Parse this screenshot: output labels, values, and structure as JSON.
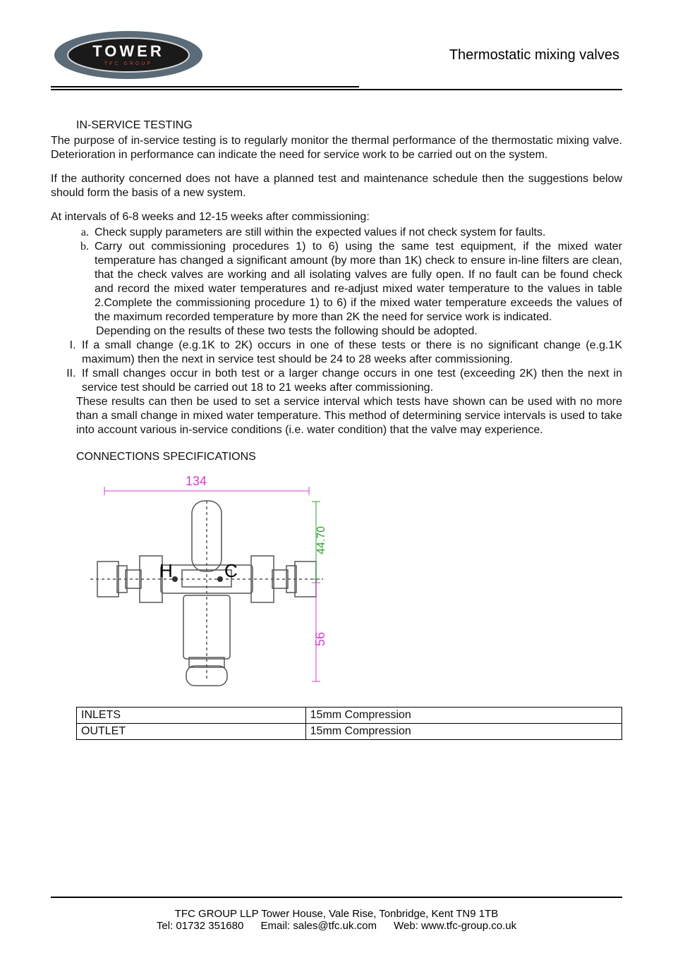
{
  "logo": {
    "brand": "TOWER",
    "sub": "TFC  GROUP"
  },
  "doc_title": "Thermostatic mixing valves",
  "section1_heading": "IN-SERVICE TESTING",
  "para1": "The purpose of in-service testing is to regularly monitor the thermal performance of the thermostatic mixing valve. Deterioration in performance can indicate the need for service work to be carried out on the system.",
  "para2": "If the authority concerned does not have a planned test and maintenance schedule then the suggestions below should form the basis of a new system.",
  "para3": "At intervals of 6-8 weeks and 12-15 weeks after commissioning:",
  "alpha_items": [
    "Check supply parameters are still within the expected values if not check system for faults.",
    "Carry out commissioning procedures 1) to 6) using the same test equipment, if the mixed water temperature has changed a significant amount (by more than 1K) check to ensure in-line filters are clean, that the check valves are working and all isolating valves are fully open. If no fault can be found check and record the mixed water temperatures and re-adjust mixed water temperature to the values in table 2.Complete the commissioning procedure 1) to 6) if the mixed water temperature exceeds the values of the maximum recorded temperature by more than 2K the need for service work is indicated."
  ],
  "alpha_b_trailer": "Depending on the results of these two tests the following should be adopted.",
  "roman_items": [
    "If a small change (e.g.1K to 2K) occurs in one of these tests or there is no significant change (e.g.1K maximum) then the next in service test should be 24 to 28 weeks after commissioning.",
    "If small changes occur in both test or a larger change occurs in one test (exceeding 2K) then the next in service test should be carried out 18 to 21 weeks after commissioning."
  ],
  "after_list": "These results can then be used to set a service interval which tests have shown can be used with no more than a small change in mixed water temperature. This method of determining service intervals is used to take into account various in-service conditions (i.e. water condition) that the valve may experience.",
  "conn_heading": "CONNECTIONS SPECIFICATIONS",
  "diagram": {
    "width_dim": "134",
    "upper_height_dim": "44.70",
    "lower_height_dim": "56",
    "hot_label": "H",
    "cold_label": "C"
  },
  "conn_table": [
    {
      "label": "INLETS",
      "value": "15mm Compression"
    },
    {
      "label": "OUTLET",
      "value": "15mm Compression"
    }
  ],
  "footer": {
    "line1": "TFC GROUP LLP Tower House, Vale Rise, Tonbridge, Kent TN9 1TB",
    "tel": "Tel: 01732 351680",
    "email": "Email: sales@tfc.uk.com",
    "web": "Web: www.tfc-group.co.uk"
  }
}
